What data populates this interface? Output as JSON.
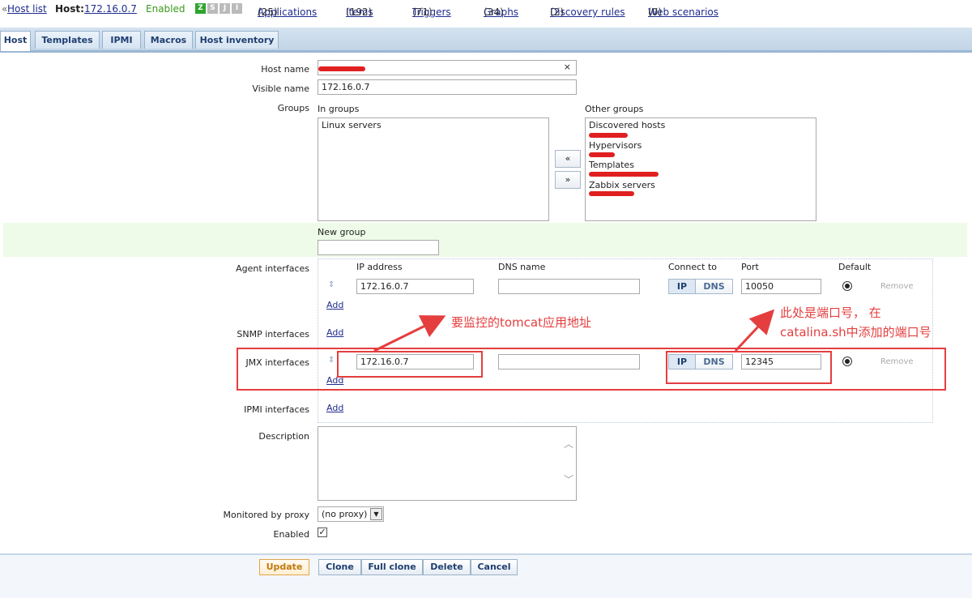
{
  "topbar": {
    "host_list": "Host list",
    "host_label": "Host:",
    "host_value": "172.16.0.7",
    "status": "Enabled",
    "avail_badges": [
      "Z",
      "S",
      "J",
      "I"
    ],
    "links": [
      {
        "label": "Applications",
        "count": "(25)"
      },
      {
        "label": "Items",
        "count": "(192)"
      },
      {
        "label": "Triggers",
        "count": "(71)"
      },
      {
        "label": "Graphs",
        "count": "(34)"
      },
      {
        "label": "Discovery rules",
        "count": "(2)"
      },
      {
        "label": "Web scenarios",
        "count": "(0)"
      }
    ]
  },
  "tabs": [
    "Host",
    "Templates",
    "IPMI",
    "Macros",
    "Host inventory"
  ],
  "form": {
    "host_name_label": "Host name",
    "visible_name_label": "Visible name",
    "visible_name_value": "172.16.0.7",
    "groups_label": "Groups",
    "in_groups_label": "In groups",
    "other_groups_label": "Other groups",
    "in_groups": [
      "Linux servers"
    ],
    "other_groups": [
      "Discovered hosts",
      "Hypervisors",
      "Templates",
      "Zabbix servers"
    ],
    "move_left": "«",
    "move_right": "»",
    "new_group_label": "New group",
    "agent_interfaces_label": "Agent interfaces",
    "snmp_interfaces_label": "SNMP interfaces",
    "jmx_interfaces_label": "JMX interfaces",
    "ipmi_interfaces_label": "IPMI interfaces",
    "col_ip": "IP address",
    "col_dns": "DNS name",
    "col_connect": "Connect to",
    "col_port": "Port",
    "col_default": "Default",
    "agent": {
      "ip": "172.16.0.7",
      "dns": "",
      "port": "10050"
    },
    "jmx": {
      "ip": "172.16.0.7",
      "dns": "",
      "port": "12345"
    },
    "ip_btn": "IP",
    "dns_btn": "DNS",
    "remove": "Remove",
    "add": "Add",
    "description_label": "Description",
    "proxy_label": "Monitored by proxy",
    "proxy_value": "(no proxy)",
    "enabled_label": "Enabled"
  },
  "annotations": {
    "ip_note": "要监控的tomcat应用地址",
    "port_note_line1": "此处是端口号， 在",
    "port_note_line2": "catalina.sh中添加的端口号"
  },
  "buttons": [
    "Update",
    "Clone",
    "Full clone",
    "Delete",
    "Cancel"
  ],
  "colors": {
    "accent": "#1f3f70",
    "annotation": "#e53e3e",
    "enabled": "#3a9a1a"
  }
}
